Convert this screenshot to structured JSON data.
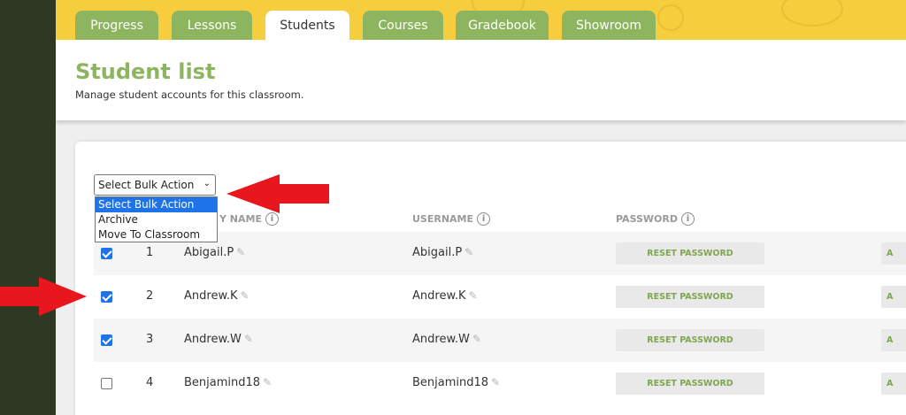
{
  "tabs": [
    {
      "label": "Progress"
    },
    {
      "label": "Lessons"
    },
    {
      "label": "Students",
      "active": true
    },
    {
      "label": "Courses"
    },
    {
      "label": "Gradebook"
    },
    {
      "label": "Showroom"
    }
  ],
  "header": {
    "title": "Student list",
    "subtitle": "Manage student accounts for this classroom."
  },
  "bulk_action": {
    "selected": "Select Bulk Action",
    "options": [
      "Select Bulk Action",
      "Archive",
      "Move To Classroom"
    ]
  },
  "columns": {
    "name_partial": "Y NAME",
    "username": "USERNAME",
    "password": "PASSWORD"
  },
  "rows": [
    {
      "checked": true,
      "num": "1",
      "name": "Abigail.P",
      "username": "Abigail.P",
      "action": "RESET PASSWORD",
      "more": "A"
    },
    {
      "checked": true,
      "num": "2",
      "name": "Andrew.K",
      "username": "Andrew.K",
      "action": "RESET PASSWORD",
      "more": "A"
    },
    {
      "checked": true,
      "num": "3",
      "name": "Andrew.W",
      "username": "Andrew.W",
      "action": "RESET PASSWORD",
      "more": "A"
    },
    {
      "checked": false,
      "num": "4",
      "name": "Benjamind18",
      "username": "Benjamind18",
      "action": "RESET PASSWORD",
      "more": "A"
    }
  ],
  "colors": {
    "accent_green": "#8db55f",
    "top_band_yellow": "#f6cd3d",
    "left_rail": "#2e3823",
    "annotation_red": "#e8161d",
    "select_highlight": "#1e73e8"
  }
}
